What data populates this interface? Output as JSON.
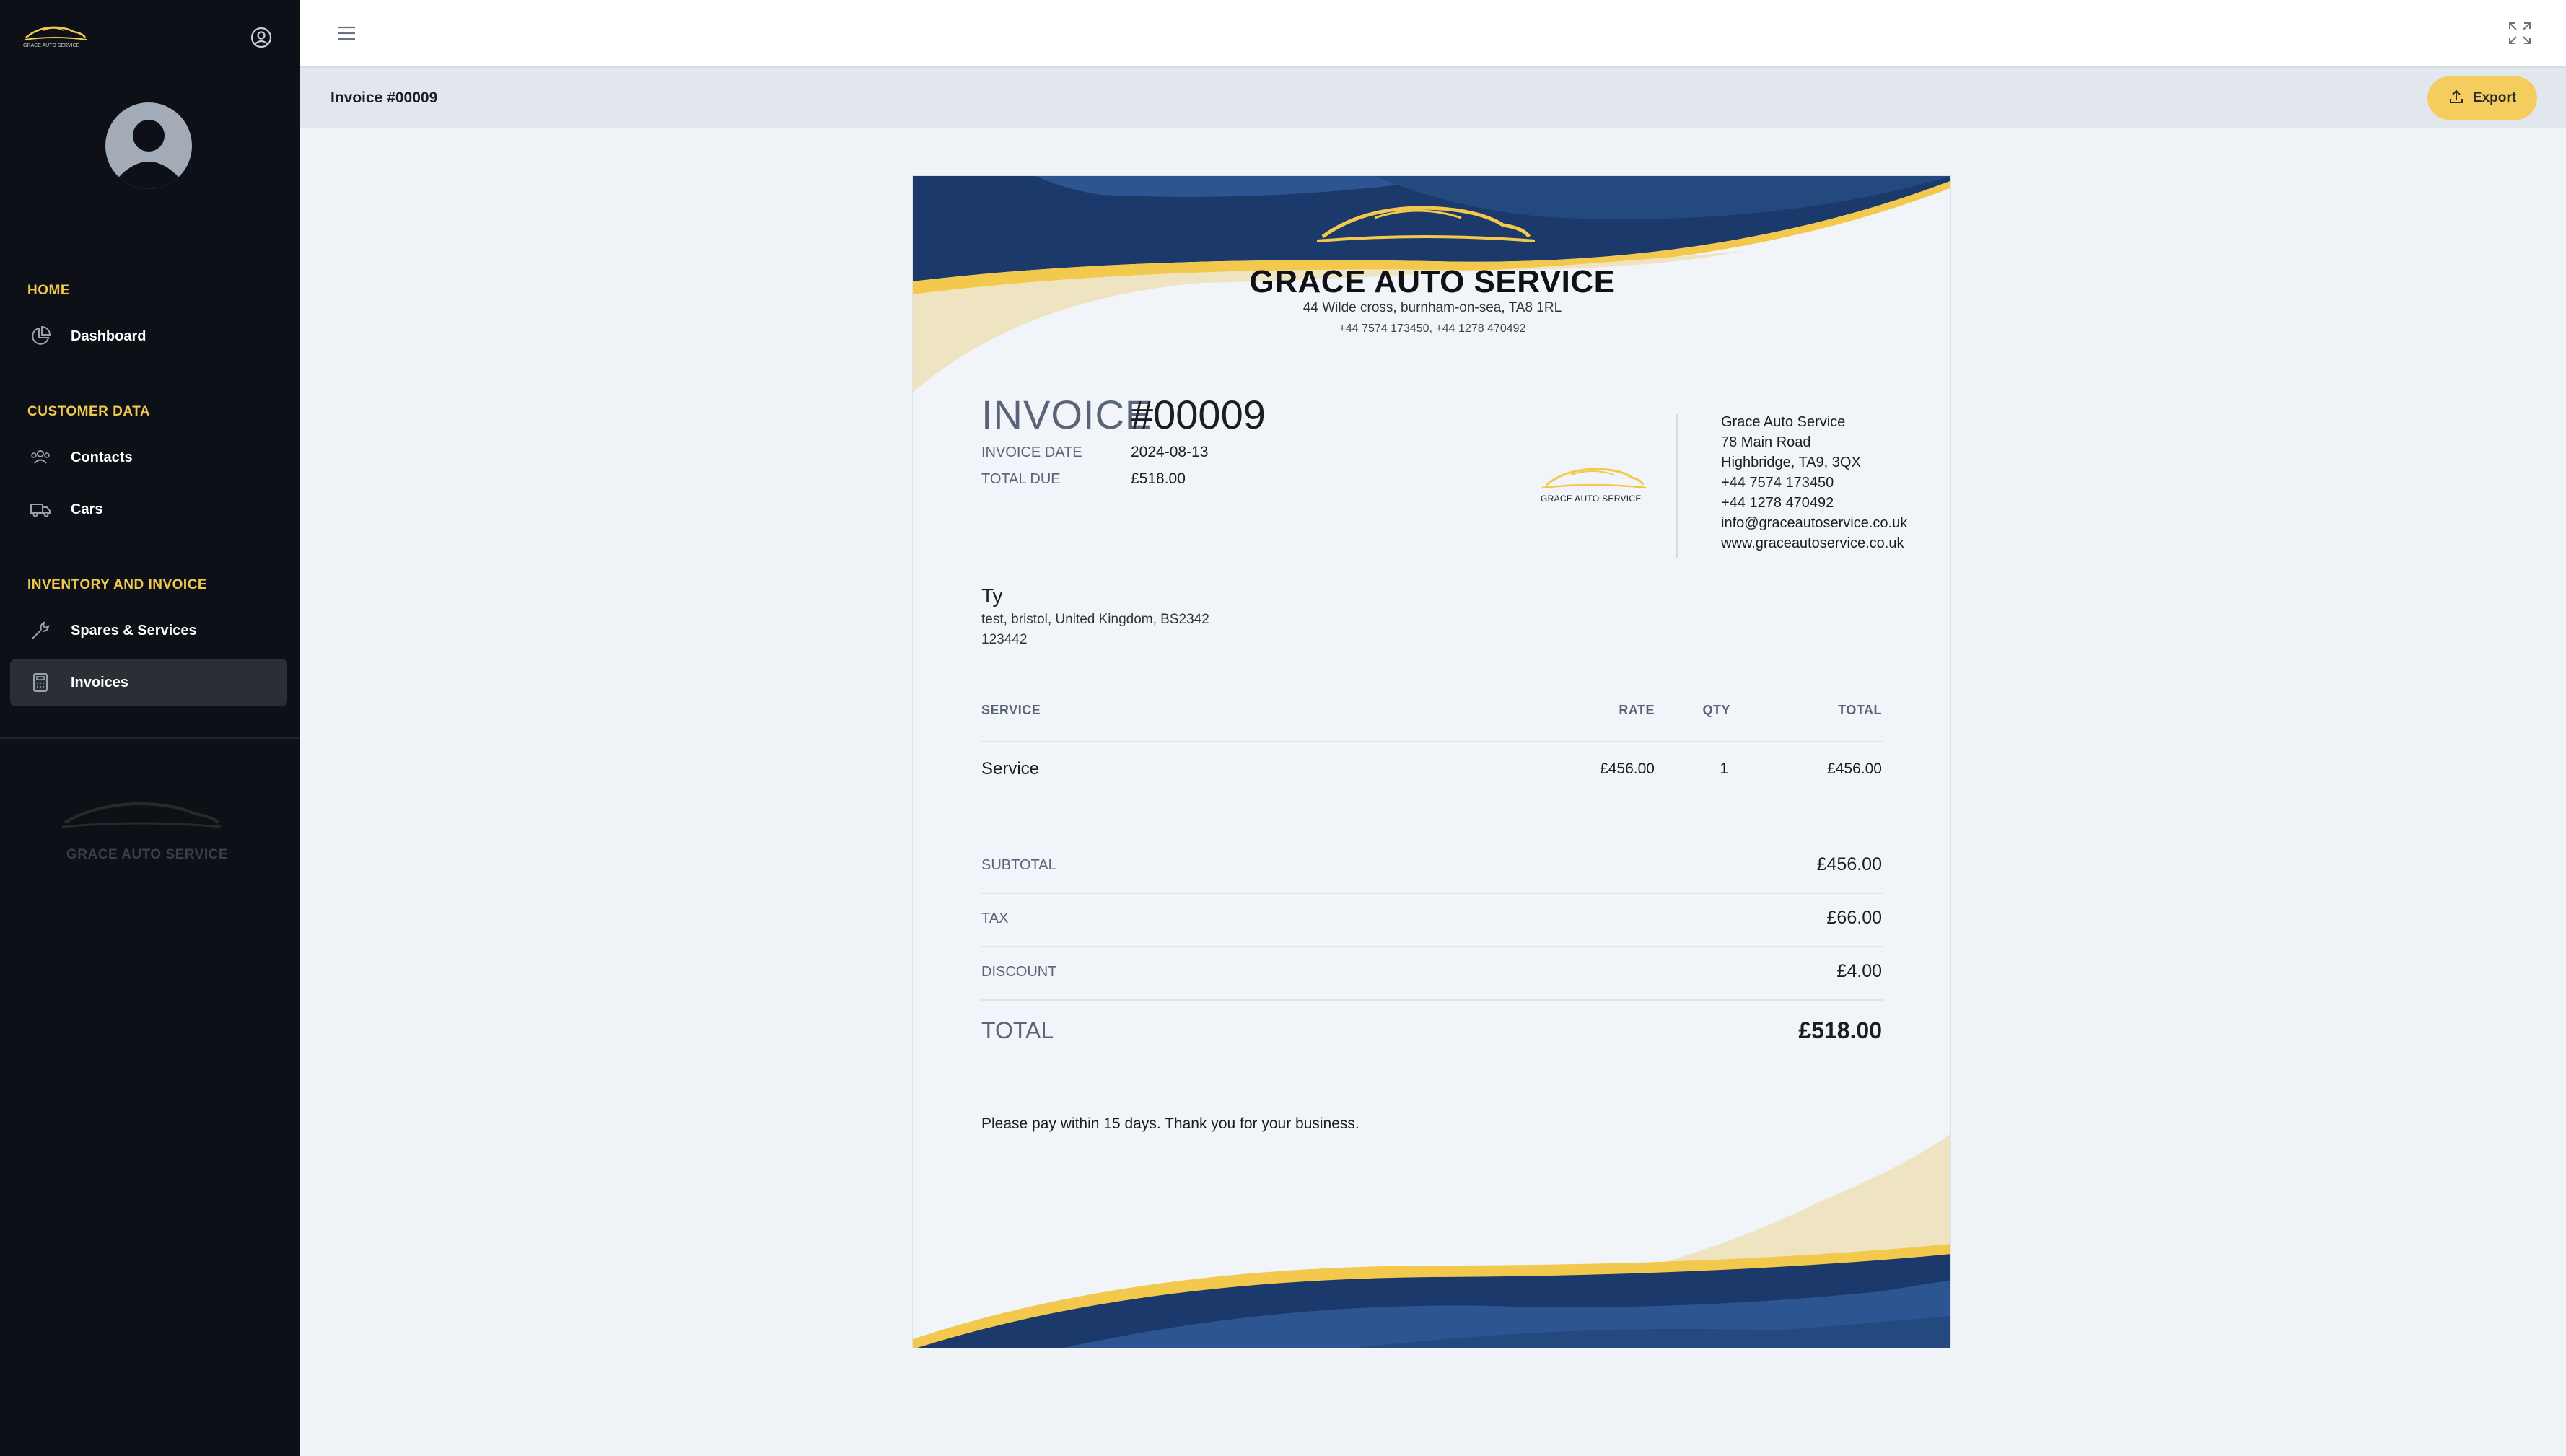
{
  "sidebar": {
    "logo_text": "GRACE AUTO SERVICE",
    "sections": [
      {
        "label": "HOME"
      },
      {
        "label": "CUSTOMER DATA"
      },
      {
        "label": "INVENTORY AND INVOICE"
      }
    ],
    "items": [
      {
        "label": "Dashboard",
        "icon": "pie-chart-icon"
      },
      {
        "label": "Contacts",
        "icon": "users-icon"
      },
      {
        "label": "Cars",
        "icon": "truck-icon"
      },
      {
        "label": "Spares & Services",
        "icon": "wrench-icon"
      },
      {
        "label": "Invoices",
        "icon": "calculator-icon",
        "active": true
      }
    ],
    "watermark_text": "GRACE AUTO SERVICE"
  },
  "header": {
    "breadcrumb_title": "Invoice #00009",
    "export_label": "Export"
  },
  "invoice": {
    "company_name": "GRACE AUTO SERVICE",
    "company_address": "44 Wilde cross, burnham-on-sea, TA8 1RL",
    "company_phones": "+44 7574 173450, +44 1278 470492",
    "invoice_word": "INVOICE",
    "number": "#00009",
    "date_label": "INVOICE DATE",
    "date_value": "2024-08-13",
    "total_due_label": "TOTAL DUE",
    "total_due_value": "£518.00",
    "logo_caption": "GRACE AUTO SERVICE",
    "from": [
      "Grace Auto Service",
      "78 Main Road",
      "Highbridge, TA9, 3QX",
      "+44 7574 173450",
      "+44 1278 470492",
      "info@graceautoservice.co.uk",
      "www.graceautoservice.co.uk"
    ],
    "bill_to": {
      "name": "Ty",
      "address": "test, bristol, United Kingdom, BS2342",
      "phone": "123442"
    },
    "columns": {
      "service": "SERVICE",
      "rate": "RATE",
      "qty": "QTY",
      "total": "TOTAL"
    },
    "lines": [
      {
        "service": "Service",
        "rate": "£456.00",
        "qty": "1",
        "total": "£456.00"
      }
    ],
    "subtotal_label": "SUBTOTAL",
    "subtotal_value": "£456.00",
    "tax_label": "TAX",
    "tax_value": "£66.00",
    "discount_label": "DISCOUNT",
    "discount_value": "£4.00",
    "total_label": "TOTAL",
    "total_value": "£518.00",
    "note": "Please pay within 15 days. Thank you for your business."
  },
  "colors": {
    "sidebar_bg": "#0d1117",
    "accent": "#f2c94c",
    "navy": "#1b3a6b",
    "cream": "#efe4c2"
  }
}
